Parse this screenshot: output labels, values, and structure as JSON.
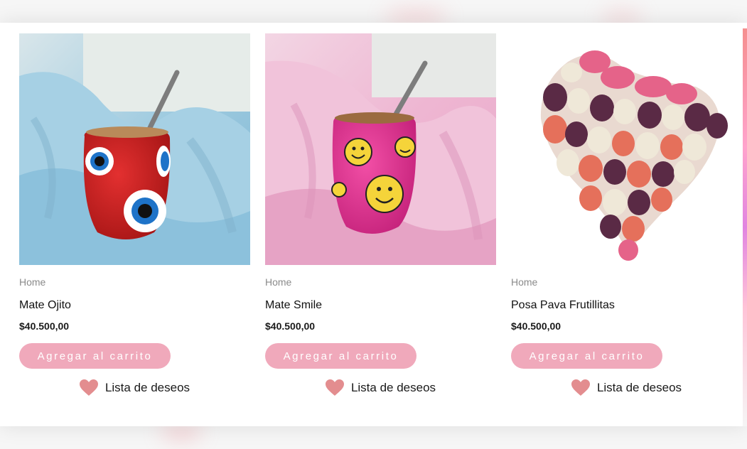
{
  "products": [
    {
      "category": "Home",
      "name": "Mate Ojito",
      "price": "$40.500,00",
      "cart_label": "Agregar al carrito",
      "wishlist_label": "Lista de deseos"
    },
    {
      "category": "Home",
      "name": "Mate Smile",
      "price": "$40.500,00",
      "cart_label": "Agregar al carrito",
      "wishlist_label": "Lista de deseos"
    },
    {
      "category": "Home",
      "name": "Posa Pava Frutillitas",
      "price": "$40.500,00",
      "cart_label": "Agregar al carrito",
      "wishlist_label": "Lista de deseos"
    }
  ],
  "colors": {
    "button_bg": "#f0a9bb",
    "heart": "#e38d8f",
    "panel_bg": "#ffffff"
  },
  "icons": {
    "wishlist": "heart-icon"
  }
}
